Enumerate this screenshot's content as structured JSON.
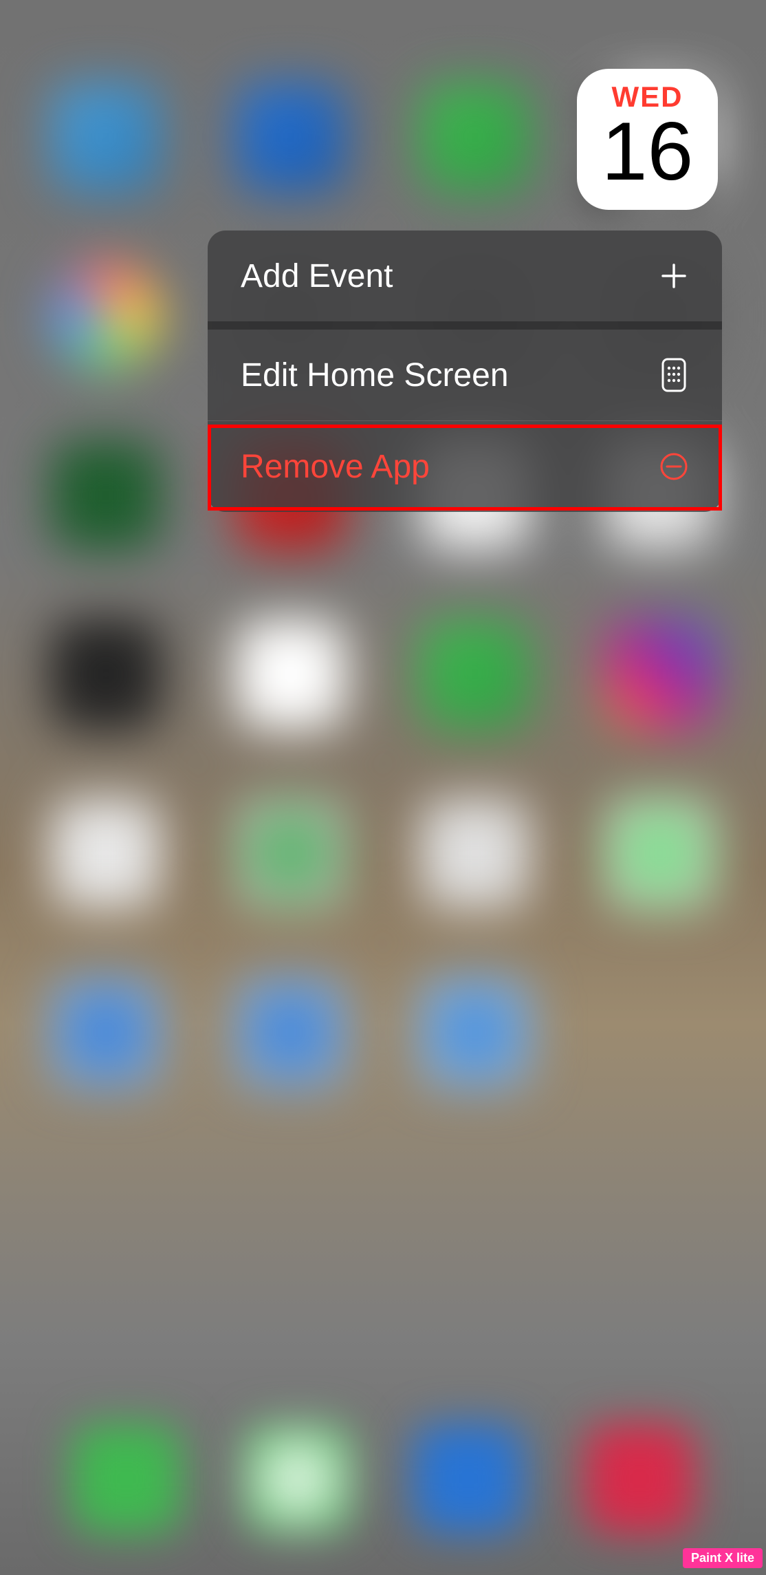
{
  "calendar": {
    "day_name": "WED",
    "day_number": "16"
  },
  "context_menu": {
    "items": [
      {
        "label": "Add Event",
        "icon": "plus-icon",
        "destructive": false
      },
      {
        "label": "Edit Home Screen",
        "icon": "phone-icon",
        "destructive": false
      },
      {
        "label": "Remove App",
        "icon": "minus-circle-icon",
        "destructive": true
      }
    ]
  },
  "watermark": "Paint X lite",
  "colors": {
    "destructive": "#ff453a",
    "menu_bg": "rgba(60, 60, 62, 0.78)",
    "highlight": "#ff0000"
  }
}
